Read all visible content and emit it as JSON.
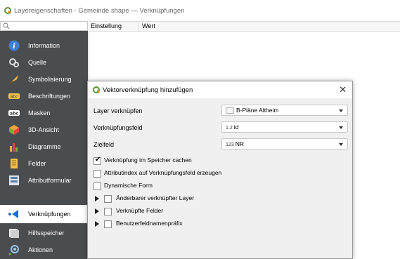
{
  "window": {
    "title": "Layereigenschaften - Gemeinde shape — Verknüpfungen"
  },
  "search": {
    "placeholder": ""
  },
  "sidebar": {
    "items": [
      {
        "label": "Information",
        "icon": "info-icon"
      },
      {
        "label": "Quelle",
        "icon": "source-icon"
      },
      {
        "label": "Symbolisierung",
        "icon": "symbology-icon"
      },
      {
        "label": "Beschriftungen",
        "icon": "labels-icon"
      },
      {
        "label": "Masken",
        "icon": "masks-icon"
      },
      {
        "label": "3D-Ansicht",
        "icon": "3d-view-icon"
      },
      {
        "label": "Diagramme",
        "icon": "diagrams-icon"
      },
      {
        "label": "Felder",
        "icon": "fields-icon"
      },
      {
        "label": "Attributformular",
        "icon": "attribute-form-icon"
      },
      {
        "label": "Verknüpfungen",
        "icon": "joins-icon",
        "active": true
      },
      {
        "label": "Hilfsspeicher",
        "icon": "auxiliary-storage-icon"
      },
      {
        "label": "Aktionen",
        "icon": "actions-icon"
      }
    ]
  },
  "table": {
    "columns": [
      "Einstellung",
      "Wert"
    ]
  },
  "dialog": {
    "title": "Vektorverknüpfung hinzufügen",
    "close": "✕",
    "fields": [
      {
        "label": "Layer verknüpfen",
        "value": "B-Pläne Altheim",
        "prefix": ""
      },
      {
        "label": "Verknüpfungsfeld",
        "value": "id",
        "prefix": "1.2"
      },
      {
        "label": "Zielfeld",
        "value": "NR",
        "prefix": "123"
      }
    ],
    "checkboxes": [
      {
        "label": "Verknüpfung im Speicher cachen",
        "checked": true
      },
      {
        "label": "Attributindex auf Verknüpfungsfeld erzeugen",
        "checked": false
      },
      {
        "label": "Dynamische Form",
        "checked": false
      }
    ],
    "groups": [
      {
        "label": "Änderbarer verknüpfter Layer"
      },
      {
        "label": "Verknüpfte Felder"
      },
      {
        "label": "Benutzerfeldnamenpräfix"
      }
    ]
  },
  "colors": {
    "sidebar_bg": "#4a4d50",
    "qgis_green": "#589632",
    "accent_blue": "#1f6fd1"
  }
}
